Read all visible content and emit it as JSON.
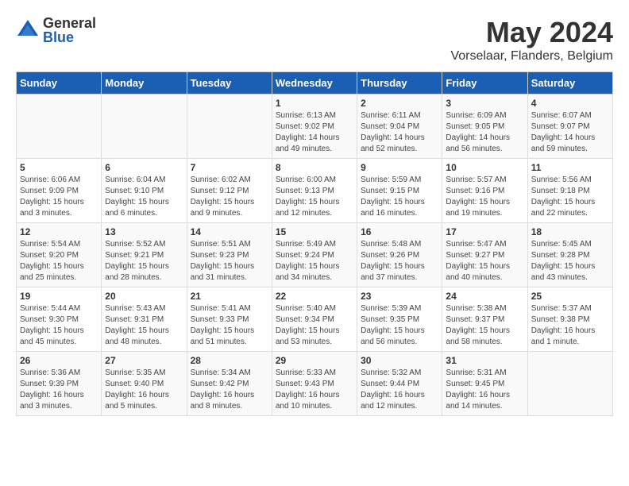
{
  "header": {
    "logo_general": "General",
    "logo_blue": "Blue",
    "month_year": "May 2024",
    "location": "Vorselaar, Flanders, Belgium"
  },
  "weekdays": [
    "Sunday",
    "Monday",
    "Tuesday",
    "Wednesday",
    "Thursday",
    "Friday",
    "Saturday"
  ],
  "weeks": [
    [
      {
        "day": "",
        "info": ""
      },
      {
        "day": "",
        "info": ""
      },
      {
        "day": "",
        "info": ""
      },
      {
        "day": "1",
        "info": "Sunrise: 6:13 AM\nSunset: 9:02 PM\nDaylight: 14 hours\nand 49 minutes."
      },
      {
        "day": "2",
        "info": "Sunrise: 6:11 AM\nSunset: 9:04 PM\nDaylight: 14 hours\nand 52 minutes."
      },
      {
        "day": "3",
        "info": "Sunrise: 6:09 AM\nSunset: 9:05 PM\nDaylight: 14 hours\nand 56 minutes."
      },
      {
        "day": "4",
        "info": "Sunrise: 6:07 AM\nSunset: 9:07 PM\nDaylight: 14 hours\nand 59 minutes."
      }
    ],
    [
      {
        "day": "5",
        "info": "Sunrise: 6:06 AM\nSunset: 9:09 PM\nDaylight: 15 hours\nand 3 minutes."
      },
      {
        "day": "6",
        "info": "Sunrise: 6:04 AM\nSunset: 9:10 PM\nDaylight: 15 hours\nand 6 minutes."
      },
      {
        "day": "7",
        "info": "Sunrise: 6:02 AM\nSunset: 9:12 PM\nDaylight: 15 hours\nand 9 minutes."
      },
      {
        "day": "8",
        "info": "Sunrise: 6:00 AM\nSunset: 9:13 PM\nDaylight: 15 hours\nand 12 minutes."
      },
      {
        "day": "9",
        "info": "Sunrise: 5:59 AM\nSunset: 9:15 PM\nDaylight: 15 hours\nand 16 minutes."
      },
      {
        "day": "10",
        "info": "Sunrise: 5:57 AM\nSunset: 9:16 PM\nDaylight: 15 hours\nand 19 minutes."
      },
      {
        "day": "11",
        "info": "Sunrise: 5:56 AM\nSunset: 9:18 PM\nDaylight: 15 hours\nand 22 minutes."
      }
    ],
    [
      {
        "day": "12",
        "info": "Sunrise: 5:54 AM\nSunset: 9:20 PM\nDaylight: 15 hours\nand 25 minutes."
      },
      {
        "day": "13",
        "info": "Sunrise: 5:52 AM\nSunset: 9:21 PM\nDaylight: 15 hours\nand 28 minutes."
      },
      {
        "day": "14",
        "info": "Sunrise: 5:51 AM\nSunset: 9:23 PM\nDaylight: 15 hours\nand 31 minutes."
      },
      {
        "day": "15",
        "info": "Sunrise: 5:49 AM\nSunset: 9:24 PM\nDaylight: 15 hours\nand 34 minutes."
      },
      {
        "day": "16",
        "info": "Sunrise: 5:48 AM\nSunset: 9:26 PM\nDaylight: 15 hours\nand 37 minutes."
      },
      {
        "day": "17",
        "info": "Sunrise: 5:47 AM\nSunset: 9:27 PM\nDaylight: 15 hours\nand 40 minutes."
      },
      {
        "day": "18",
        "info": "Sunrise: 5:45 AM\nSunset: 9:28 PM\nDaylight: 15 hours\nand 43 minutes."
      }
    ],
    [
      {
        "day": "19",
        "info": "Sunrise: 5:44 AM\nSunset: 9:30 PM\nDaylight: 15 hours\nand 45 minutes."
      },
      {
        "day": "20",
        "info": "Sunrise: 5:43 AM\nSunset: 9:31 PM\nDaylight: 15 hours\nand 48 minutes."
      },
      {
        "day": "21",
        "info": "Sunrise: 5:41 AM\nSunset: 9:33 PM\nDaylight: 15 hours\nand 51 minutes."
      },
      {
        "day": "22",
        "info": "Sunrise: 5:40 AM\nSunset: 9:34 PM\nDaylight: 15 hours\nand 53 minutes."
      },
      {
        "day": "23",
        "info": "Sunrise: 5:39 AM\nSunset: 9:35 PM\nDaylight: 15 hours\nand 56 minutes."
      },
      {
        "day": "24",
        "info": "Sunrise: 5:38 AM\nSunset: 9:37 PM\nDaylight: 15 hours\nand 58 minutes."
      },
      {
        "day": "25",
        "info": "Sunrise: 5:37 AM\nSunset: 9:38 PM\nDaylight: 16 hours\nand 1 minute."
      }
    ],
    [
      {
        "day": "26",
        "info": "Sunrise: 5:36 AM\nSunset: 9:39 PM\nDaylight: 16 hours\nand 3 minutes."
      },
      {
        "day": "27",
        "info": "Sunrise: 5:35 AM\nSunset: 9:40 PM\nDaylight: 16 hours\nand 5 minutes."
      },
      {
        "day": "28",
        "info": "Sunrise: 5:34 AM\nSunset: 9:42 PM\nDaylight: 16 hours\nand 8 minutes."
      },
      {
        "day": "29",
        "info": "Sunrise: 5:33 AM\nSunset: 9:43 PM\nDaylight: 16 hours\nand 10 minutes."
      },
      {
        "day": "30",
        "info": "Sunrise: 5:32 AM\nSunset: 9:44 PM\nDaylight: 16 hours\nand 12 minutes."
      },
      {
        "day": "31",
        "info": "Sunrise: 5:31 AM\nSunset: 9:45 PM\nDaylight: 16 hours\nand 14 minutes."
      },
      {
        "day": "",
        "info": ""
      }
    ]
  ]
}
